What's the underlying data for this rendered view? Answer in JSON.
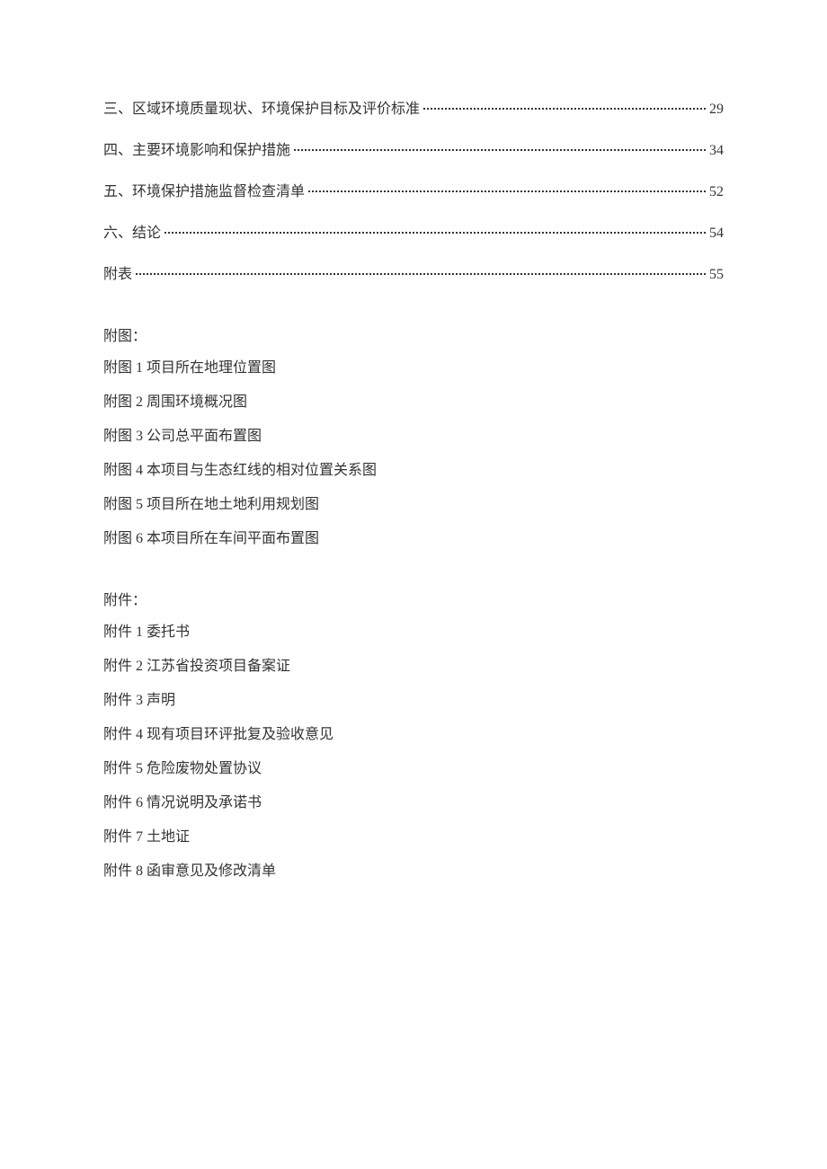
{
  "toc": [
    {
      "label": "三、区域环境质量现状、环境保护目标及评价标准",
      "page": "29"
    },
    {
      "label": "四、主要环境影响和保护措施",
      "page": "34"
    },
    {
      "label": "五、环境保护措施监督检查清单",
      "page": "52"
    },
    {
      "label": "六、结论",
      "page": "54"
    },
    {
      "label": "附表",
      "page": "55"
    }
  ],
  "figures_heading": "附图：",
  "figures": [
    "附图 1 项目所在地理位置图",
    "附图 2 周围环境概况图",
    "附图 3 公司总平面布置图",
    "附图 4 本项目与生态红线的相对位置关系图",
    "附图 5 项目所在地土地利用规划图",
    "附图 6 本项目所在车间平面布置图"
  ],
  "attachments_heading": "附件：",
  "attachments": [
    "附件 1 委托书",
    "附件 2 江苏省投资项目备案证",
    "附件 3 声明",
    "附件 4 现有项目环评批复及验收意见",
    "附件 5 危险废物处置协议",
    "附件 6 情况说明及承诺书",
    "附件 7 土地证",
    "附件 8 函审意见及修改清单"
  ]
}
